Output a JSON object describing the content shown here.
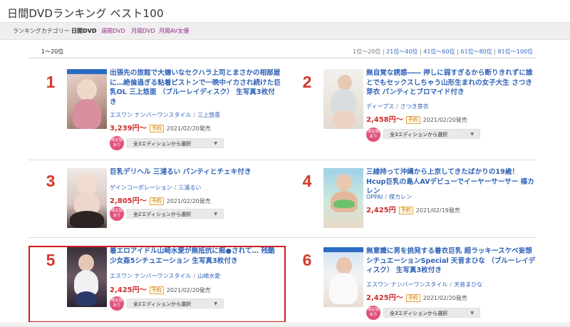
{
  "page_title": "日間DVDランキング ベスト100",
  "categories": {
    "label": "ランキングカテゴリー",
    "items": [
      "日間DVD",
      "週間DVD",
      "月間DVD",
      "月間AV女優"
    ],
    "selected": "日間DVD"
  },
  "range": {
    "current": "1〜20位",
    "links": [
      "1位〜20位",
      "21位〜40位",
      "41位〜60位",
      "61位〜80位",
      "81位〜100位"
    ],
    "separator": "|"
  },
  "colors": {
    "accent_link": "#2f62b8",
    "rank": "#d23a2a",
    "price": "#d02b2b",
    "highlight_border": "#d01e1e"
  },
  "items": [
    {
      "rank": "1",
      "title": "出張先の旅館で大嫌いなセクハラ上司とまさかの相部屋に…絶倫過ぎる粘着ピストンで一晩中イカされ続けた巨乳OL 三上悠亜 （ブルーレイディスク） 生写真3枚付き",
      "maker": "エスワン ナンバーワンスタイル",
      "actor": "三上悠亜",
      "price": "3,239円〜",
      "badge": "予約",
      "release": "2021/02/20発売",
      "limited": "限定版あり",
      "edition": "全3エディションから選択"
    },
    {
      "rank": "2",
      "title": "無自覚な誘惑―― 押しに弱すぎるから断りきれずに誰とでもセックスしちゃう山形生まれの女子大生 さつき芽衣 パンティとブロマイド付き",
      "maker": "ディープス",
      "actor": "さつき芽衣",
      "price": "2,458円〜",
      "badge": "予約",
      "release": "2021/02/20発売",
      "limited": "限定版あり",
      "edition": "全3エディションから選択"
    },
    {
      "rank": "3",
      "title": "巨乳デリヘル 三浦るい パンティとチェキ付き",
      "maker": "ゲインコーポレーション",
      "actor": "三浦るい",
      "price": "2,805円〜",
      "badge": "予約",
      "release": "2021/02/20発売",
      "limited": "限定版あり",
      "edition": "全2エディションから選択"
    },
    {
      "rank": "4",
      "title": "三線持って沖縄から上京してきたばかりの19歳！Hcup巨乳の島人AVデビューでイーヤーサーサー 楪カレン",
      "maker": "OPPAI",
      "actor": "楪カレン",
      "price": "2,425円",
      "badge": "予約",
      "release": "2021/02/19発売",
      "limited": "",
      "edition": ""
    },
    {
      "rank": "5",
      "title": "着エロアイドル山崎水愛が無抵抗に痴●されて… 残酷少女姦5シチュエーション 生写真3枚付き",
      "maker": "エスワン ナンバーワンスタイル",
      "actor": "山崎水愛",
      "price": "2,425円〜",
      "badge": "予約",
      "release": "2021/02/20発売",
      "limited": "限定版あり",
      "edition": "全2エディションから選択"
    },
    {
      "rank": "6",
      "title": "無意識に男を挑発する着衣巨乳 超ラッキースケベ妄想シチュエーションSpecial 天音まひな （ブルーレイディスク） 生写真3枚付き",
      "maker": "エスワン ナンバーワンスタイル",
      "actor": "天音まひな",
      "price": "2,425円〜",
      "badge": "予約",
      "release": "2021/02/20発売",
      "limited": "限定版あり",
      "edition": "全3エディションから選択"
    }
  ]
}
